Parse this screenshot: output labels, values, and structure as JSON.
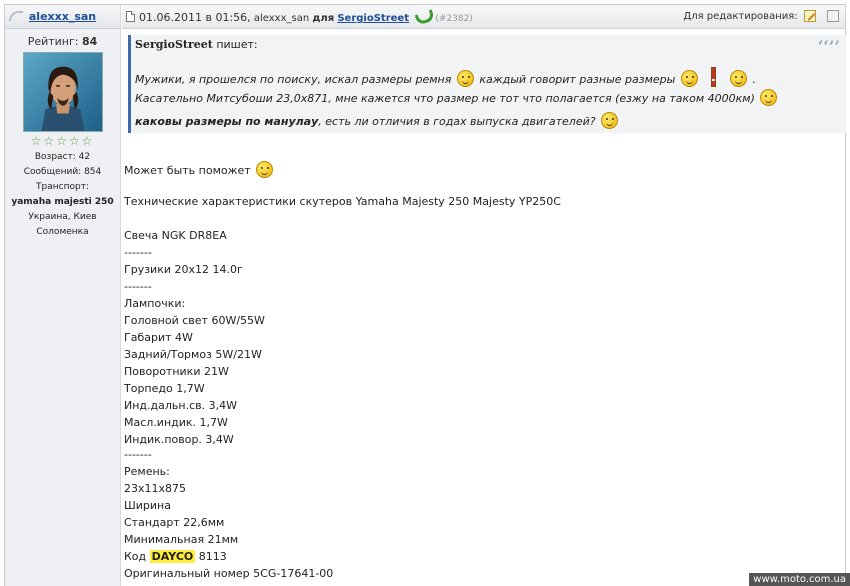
{
  "author": {
    "name": "alexxx_san",
    "rating_label": "Рейтинг:",
    "rating_value": "84",
    "stars": "☆☆☆☆☆",
    "age": "Возраст: 42",
    "messages": "Сообщений: 854",
    "transport_label": "Транспорт:",
    "transport_value": "yamaha majesti 250",
    "location": "Украина, Киев",
    "district": "Соломенка"
  },
  "post_header": {
    "date": "01.06.2011 в 01:56,",
    "user": "alexxx_san",
    "to_label": "для",
    "target": "SergioStreet",
    "number": "(#2382)",
    "edit_label": "Для редактирования:"
  },
  "quote": {
    "author": "SergioStreet",
    "says": "пишет:",
    "mark": "‘‘’’",
    "line1": "Мужики, я прошелся по поиску, искал размеры ремня",
    "line1b": "каждый говорит разные размеры",
    "line1c": ".",
    "line2": "Касательно Митсубоши 23,0х871, мне кажется что размер не тот что полагается (езжу на таком 4000км)",
    "line3_bold": "каковы размеры по манулау",
    "line3": ", есть ли отличия в годах выпуска двигателей?"
  },
  "body": {
    "maybe": "Может быть поможет",
    "specs_title": "Технические характеристики скутеров Yamaha Majesty 250 Majesty YP250C",
    "plug": "Свеча NGK DR8EA",
    "sep1": "-------",
    "weights": "Грузики 20x12 14.0г",
    "sep2": "-------",
    "lamps": "Лампочки:",
    "headlight": "Головной свет 60W/55W",
    "parking": "Габарит 4W",
    "rear": "Задний/Тормоз 5W/21W",
    "turns": "Поворотники 21W",
    "dash": "Торпедо 1,7W",
    "ind_far": "Инд.дальн.св. 3,4W",
    "ind_oil": "Масл.индик. 1,7W",
    "ind_turn": "Индик.повор. 3,4W",
    "sep3": "-------",
    "belt": "Ремень:",
    "belt_size": "23x11x875",
    "width": "Ширина",
    "standard": "Стандарт 22,6мм",
    "minimal": "Минимальная 21мм",
    "code_label": "Код",
    "code_brand": "DAYCO",
    "code_num": "8113",
    "original": "Оригинальный номер 5CG-17641-00"
  },
  "watermark": "www.moto.com.ua"
}
